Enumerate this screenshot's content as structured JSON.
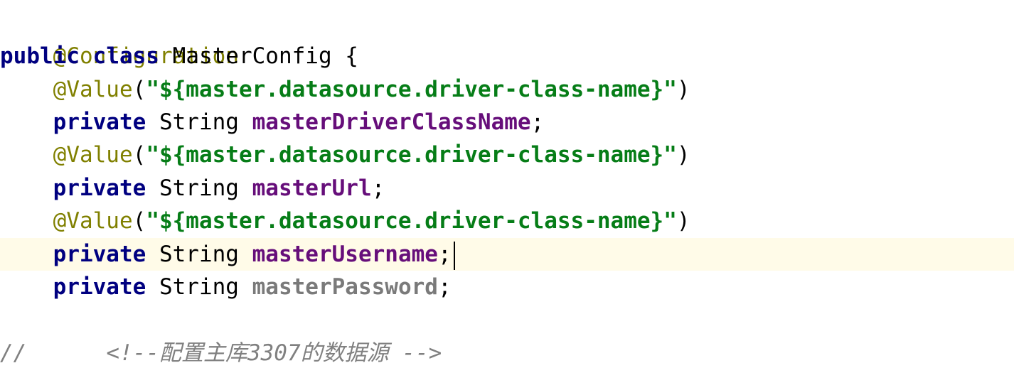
{
  "code": {
    "line1": {
      "annotation": "@Configuration"
    },
    "line2": {
      "kw1": "public",
      "kw2": "class",
      "class_name": "MasterConfig",
      "brace": "{"
    },
    "fields": [
      {
        "annotation": "@Value",
        "open": "(",
        "value_string": "\"${master.datasource.driver-class-name}\"",
        "close": ")",
        "modifier": "private",
        "type": "String",
        "name": "masterDriverClassName",
        "semicolon": ";"
      },
      {
        "annotation": "@Value",
        "open": "(",
        "value_string": "\"${master.datasource.driver-class-name}\"",
        "close": ")",
        "modifier": "private",
        "type": "String",
        "name": "masterUrl",
        "semicolon": ";"
      },
      {
        "annotation": "@Value",
        "open": "(",
        "value_string": "\"${master.datasource.driver-class-name}\"",
        "close": ")",
        "modifier": "private",
        "type": "String",
        "name": "masterUsername",
        "semicolon": ";"
      }
    ],
    "last_field": {
      "modifier": "private",
      "type": "String",
      "name": "masterPassword",
      "semicolon": ";"
    },
    "comment": {
      "slashes": "//",
      "text": "<!--配置主库3307的数据源 -->"
    }
  },
  "colors": {
    "keyword": "#000080",
    "annotation": "#808000",
    "string": "#067d17",
    "field": "#660e7a",
    "unused_field": "#7a7a7a",
    "comment": "#808080",
    "current_line": "#fffbe8"
  }
}
